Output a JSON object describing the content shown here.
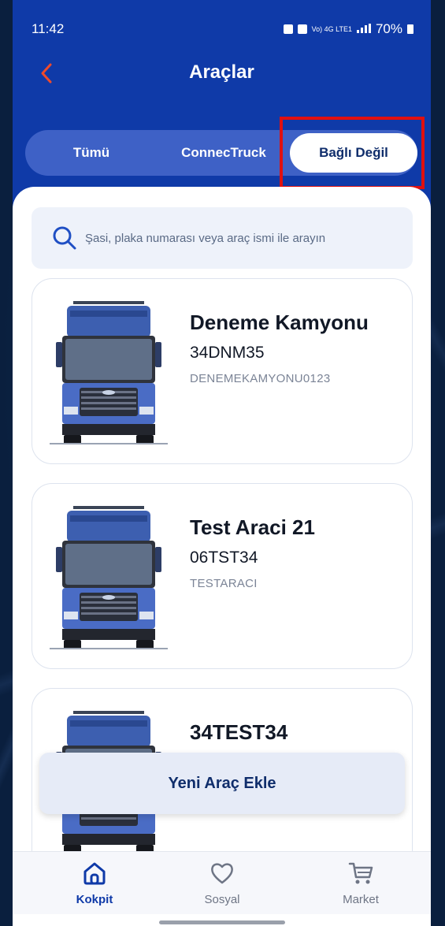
{
  "status_bar": {
    "time": "11:42",
    "network": "Vo) 4G LTE1",
    "battery": "70%"
  },
  "header": {
    "title": "Araçlar",
    "back_icon": "chevron-left-icon",
    "accent": "#f04a2a",
    "background": "#0f3aa8"
  },
  "tabs": [
    {
      "label": "Tümü",
      "active": false
    },
    {
      "label": "ConnecTruck",
      "active": false
    },
    {
      "label": "Bağlı Değil",
      "active": true
    }
  ],
  "search": {
    "placeholder": "Şasi, plaka numarası veya araç ismi ile arayın",
    "icon": "search-icon"
  },
  "vehicles": [
    {
      "name": "Deneme Kamyonu",
      "plate": "34DNM35",
      "code": "DENEMEKAMYONU0123"
    },
    {
      "name": "Test Araci 21",
      "plate": "06TST34",
      "code": "TESTARACI"
    },
    {
      "name": "34TEST34",
      "plate": "",
      "code": ""
    }
  ],
  "add_button": {
    "label": "Yeni Araç Ekle"
  },
  "bottom_nav": [
    {
      "label": "Kokpit",
      "icon": "home-icon",
      "active": true
    },
    {
      "label": "Sosyal",
      "icon": "heart-icon",
      "active": false
    },
    {
      "label": "Market",
      "icon": "cart-icon",
      "active": false
    }
  ]
}
